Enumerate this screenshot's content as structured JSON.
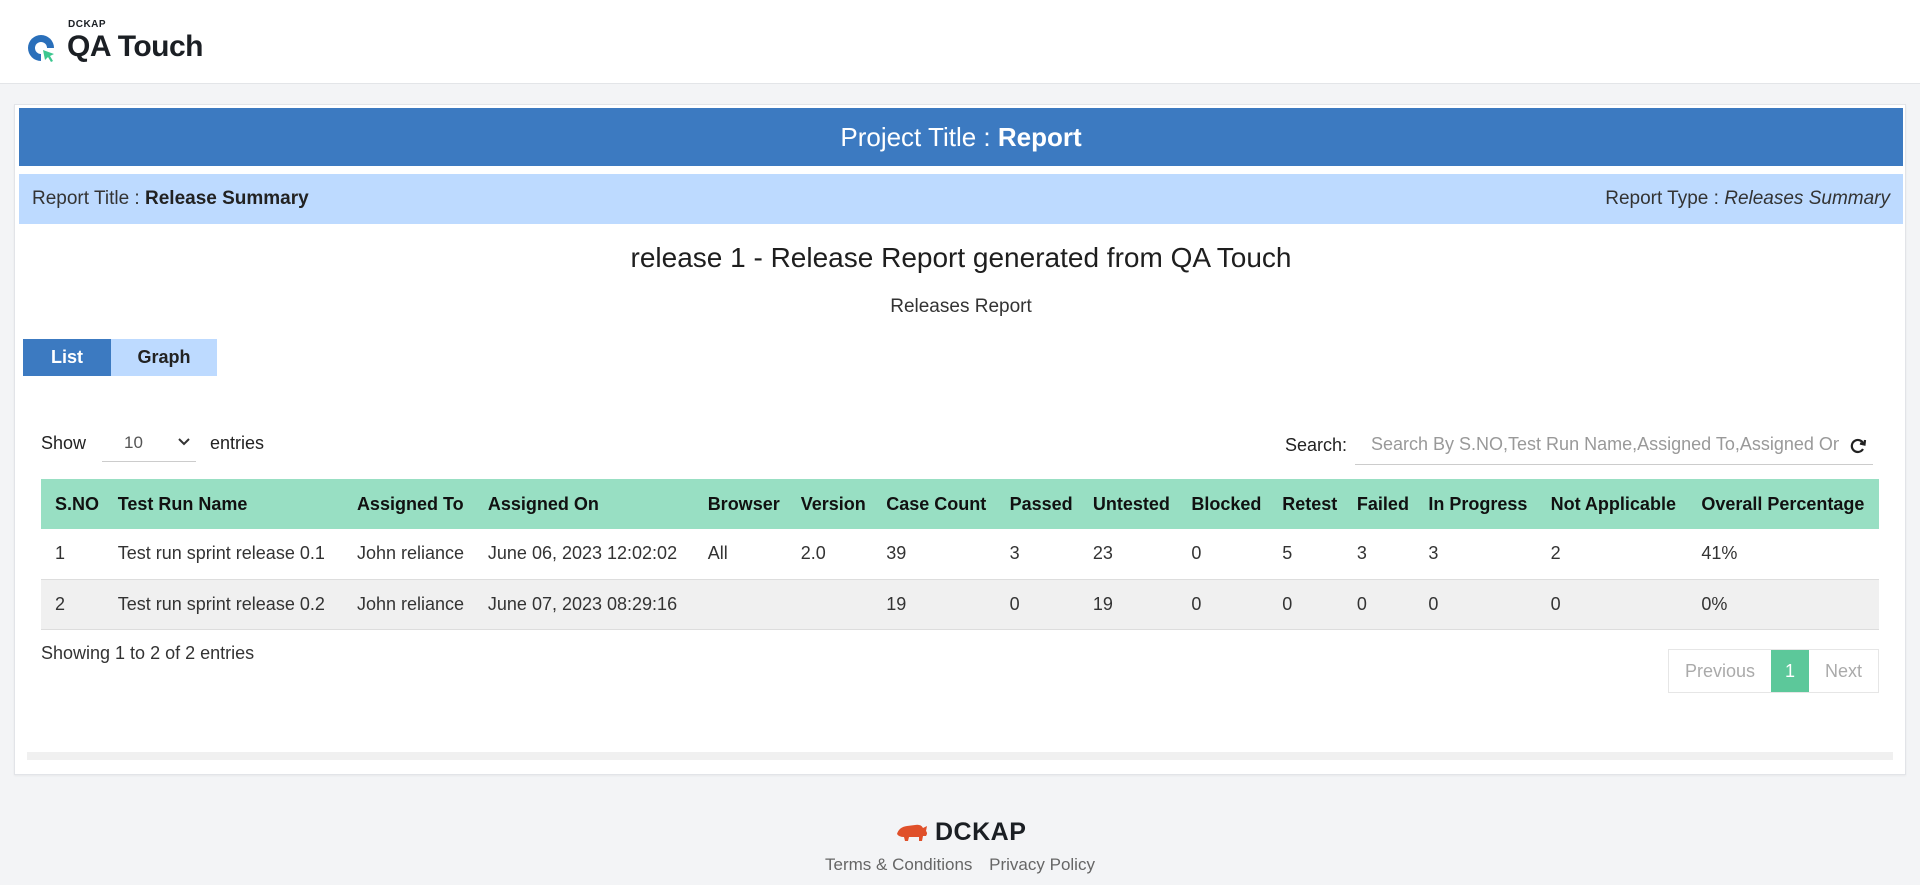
{
  "header": {
    "brand_small": "DCKAP",
    "brand_name": "QA Touch"
  },
  "project_bar": {
    "label": "Project Title : ",
    "value": "Report",
    "color": "#3c7ac1"
  },
  "report_bar": {
    "title_label": "Report Title : ",
    "title_value": "Release Summary",
    "type_label": "Report Type : ",
    "type_value": "Releases Summary"
  },
  "main_title": "release 1 - Release Report generated from QA Touch",
  "sub_title": "Releases Report",
  "tabs": [
    {
      "label": "List",
      "active": true
    },
    {
      "label": "Graph",
      "active": false
    }
  ],
  "show_entries": {
    "show_label": "Show",
    "value": "10",
    "entries_label": "entries"
  },
  "search": {
    "label": "Search:",
    "placeholder": "Search By S.NO,Test Run Name,Assigned To,Assigned On,Browser"
  },
  "table": {
    "columns": [
      "S.NO",
      "Test Run Name",
      "Assigned To",
      "Assigned On",
      "Browser",
      "Version",
      "Case Count",
      "Passed",
      "Untested",
      "Blocked",
      "Retest",
      "Failed",
      "In Progress",
      "Not Applicable",
      "Overall Percentage"
    ],
    "rows": [
      [
        "1",
        "Test run sprint release 0.1",
        "John reliance",
        "June 06, 2023 12:02:02",
        "All",
        "2.0",
        "39",
        "3",
        "23",
        "0",
        "5",
        "3",
        "3",
        "2",
        "41%"
      ],
      [
        "2",
        "Test run sprint release 0.2",
        "John reliance",
        "June 07, 2023 08:29:16",
        "",
        "",
        "19",
        "0",
        "19",
        "0",
        "0",
        "0",
        "0",
        "0",
        "0%"
      ]
    ],
    "header_color": "#98dfc3"
  },
  "info": "Showing 1 to 2 of 2 entries",
  "pagination": {
    "previous": "Previous",
    "current": "1",
    "next": "Next"
  },
  "footer": {
    "brand": "DCKAP",
    "links": [
      "Terms & Conditions",
      "Privacy Policy"
    ]
  },
  "icons": {
    "logo": "qa-touch-logo-icon",
    "chevron": "chevron-down-icon",
    "refresh": "refresh-icon",
    "footer": "dckap-rhino-icon"
  }
}
